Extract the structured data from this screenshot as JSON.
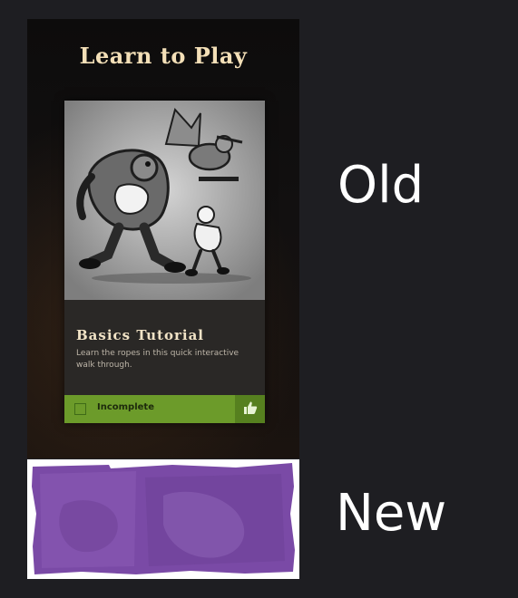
{
  "old_panel": {
    "title": "Learn to Play",
    "card": {
      "title": "Basics Tutorial",
      "description": "Learn the ropes in this quick interactive walk through.",
      "status": "Incomplete"
    },
    "icons": {
      "status_checkbox": "checkbox-icon",
      "approve": "thumbs-up-icon"
    },
    "colors": {
      "status_bar": "#6c9b2a",
      "title_text": "#f3dfb7"
    }
  },
  "new_panel": {
    "colors": {
      "fill": "#7a4aa6"
    }
  },
  "labels": {
    "old": "Old",
    "new": "New"
  }
}
